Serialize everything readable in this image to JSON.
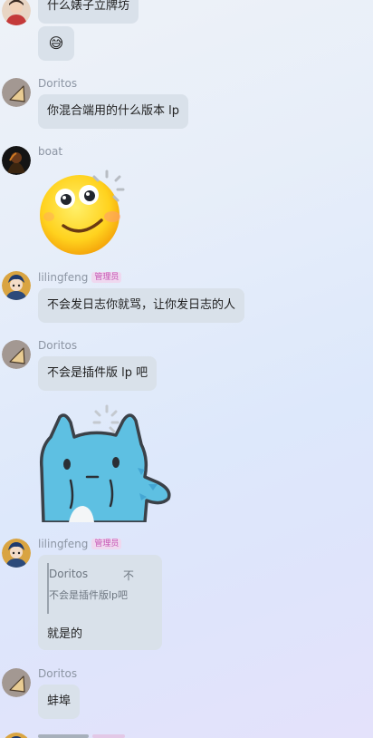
{
  "messages": [
    {
      "text": "什么婊子立牌坊"
    },
    {
      "emoji": "😅"
    },
    {
      "author": "Doritos",
      "text": "你混合端用的什么版本 lp"
    },
    {
      "author": "boat",
      "sticker": "smiling-face-sticker"
    },
    {
      "author": "lilingfeng",
      "badge": "管理员",
      "text": "不会发日志你就骂，让你发日志的人"
    },
    {
      "author": "Doritos",
      "text": "不会是插件版 lp 吧"
    },
    {
      "sticker": "blue-cat-sticker"
    },
    {
      "author": "lilingfeng",
      "badge": "管理员",
      "reply": {
        "author": "Doritos",
        "flag": "不",
        "text": "不会是插件版lp吧"
      },
      "text": "就是的"
    },
    {
      "author": "Doritos",
      "text": "蚌埠"
    }
  ]
}
